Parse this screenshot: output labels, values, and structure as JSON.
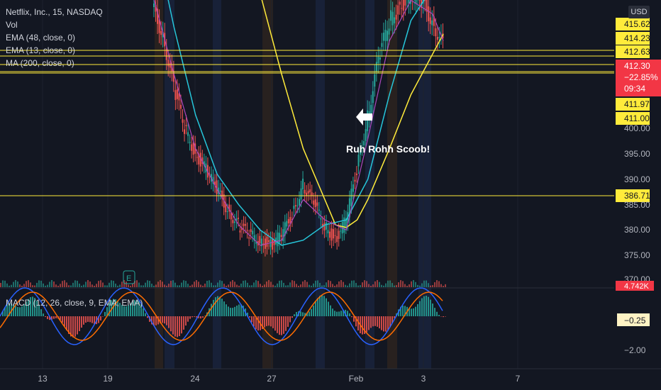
{
  "legend": {
    "symbol_line": "Netflix, Inc., 15, NASDAQ",
    "vol": "Vol",
    "ema48": "EMA (48, close, 0)",
    "ema13": "EMA (13, close, 0)",
    "ma200": "MA (200, close, 0)"
  },
  "macd_legend": "MACD (12, 26, close, 9, EMA, EMA)",
  "currency": "USD",
  "annotation": "Ruh Rohh Scoob!",
  "colors": {
    "background": "#131722",
    "up": "#26a69a",
    "down": "#ef5350",
    "ema48": "#26c6da",
    "ema13": "#ab47bc",
    "ma200": "#ffeb3b",
    "hline": "#ffeb3b",
    "macd_line": "#2962ff",
    "signal_line": "#ff6d00",
    "price_label": "#f23645",
    "session_shade_blue": "#1e2a4a",
    "session_shade_orange": "#3a2a1e"
  },
  "chart_data": {
    "type": "line",
    "y_ticks": [
      "415.62",
      "414.23",
      "412.63",
      "412.30",
      "411.97",
      "411.00",
      "400.00",
      "395.00",
      "390.00",
      "386.71",
      "385.00",
      "380.00",
      "375.00",
      "370.00"
    ],
    "x_ticks": [
      "13",
      "19",
      "24",
      "27",
      "Feb",
      "3",
      "7"
    ],
    "ylim": [
      369,
      422
    ],
    "horizontal_levels": [
      415.62,
      414.23,
      412.63,
      411.97,
      411.0,
      386.71
    ],
    "current_price": {
      "value": "412.30",
      "change": "−22.85%",
      "timer": "09:34"
    },
    "volume_label": "4.742K",
    "macd": {
      "current": "−0.25",
      "ticks": [
        "−2.00"
      ]
    },
    "price_series": [
      {
        "x": 0,
        "y": 418
      },
      {
        "x": 1,
        "y": 414
      },
      {
        "x": 2,
        "y": 406
      },
      {
        "x": 3,
        "y": 400
      },
      {
        "x": 4,
        "y": 395
      },
      {
        "x": 5,
        "y": 392
      },
      {
        "x": 6,
        "y": 388
      },
      {
        "x": 7,
        "y": 384
      },
      {
        "x": 8,
        "y": 381
      },
      {
        "x": 9,
        "y": 379
      },
      {
        "x": 10,
        "y": 378
      },
      {
        "x": 11,
        "y": 377
      },
      {
        "x": 12,
        "y": 379
      },
      {
        "x": 13,
        "y": 383
      },
      {
        "x": 14,
        "y": 389
      },
      {
        "x": 15,
        "y": 385
      },
      {
        "x": 16,
        "y": 381
      },
      {
        "x": 17,
        "y": 378
      },
      {
        "x": 18,
        "y": 382
      },
      {
        "x": 19,
        "y": 392
      },
      {
        "x": 20,
        "y": 402
      },
      {
        "x": 21,
        "y": 410
      },
      {
        "x": 22,
        "y": 416
      },
      {
        "x": 23,
        "y": 418
      },
      {
        "x": 24,
        "y": 420
      },
      {
        "x": 25,
        "y": 419
      },
      {
        "x": 26,
        "y": 416
      },
      {
        "x": 27,
        "y": 412.3
      }
    ],
    "ema48": [
      {
        "x": 0,
        "y": 430
      },
      {
        "x": 2,
        "y": 415
      },
      {
        "x": 4,
        "y": 402
      },
      {
        "x": 6,
        "y": 391
      },
      {
        "x": 8,
        "y": 385
      },
      {
        "x": 10,
        "y": 380
      },
      {
        "x": 12,
        "y": 377
      },
      {
        "x": 14,
        "y": 378
      },
      {
        "x": 16,
        "y": 381
      },
      {
        "x": 18,
        "y": 382
      },
      {
        "x": 20,
        "y": 390
      },
      {
        "x": 22,
        "y": 405
      },
      {
        "x": 24,
        "y": 416
      },
      {
        "x": 26,
        "y": 421
      },
      {
        "x": 27,
        "y": 422
      }
    ],
    "ema13": [
      {
        "x": 0,
        "y": 420
      },
      {
        "x": 2,
        "y": 408
      },
      {
        "x": 4,
        "y": 396
      },
      {
        "x": 6,
        "y": 388
      },
      {
        "x": 8,
        "y": 381
      },
      {
        "x": 10,
        "y": 377
      },
      {
        "x": 12,
        "y": 378
      },
      {
        "x": 14,
        "y": 386
      },
      {
        "x": 16,
        "y": 382
      },
      {
        "x": 18,
        "y": 380
      },
      {
        "x": 20,
        "y": 398
      },
      {
        "x": 22,
        "y": 413
      },
      {
        "x": 24,
        "y": 419
      },
      {
        "x": 26,
        "y": 417
      },
      {
        "x": 27,
        "y": 413
      }
    ],
    "ma200": [
      {
        "x": 8,
        "y": 432
      },
      {
        "x": 10,
        "y": 420
      },
      {
        "x": 12,
        "y": 408
      },
      {
        "x": 14,
        "y": 396
      },
      {
        "x": 16,
        "y": 386
      },
      {
        "x": 17,
        "y": 381
      },
      {
        "x": 18,
        "y": 380.5
      },
      {
        "x": 19,
        "y": 382
      },
      {
        "x": 20,
        "y": 386
      },
      {
        "x": 22,
        "y": 396
      },
      {
        "x": 24,
        "y": 405
      },
      {
        "x": 26,
        "y": 411
      },
      {
        "x": 27,
        "y": 414
      }
    ]
  }
}
